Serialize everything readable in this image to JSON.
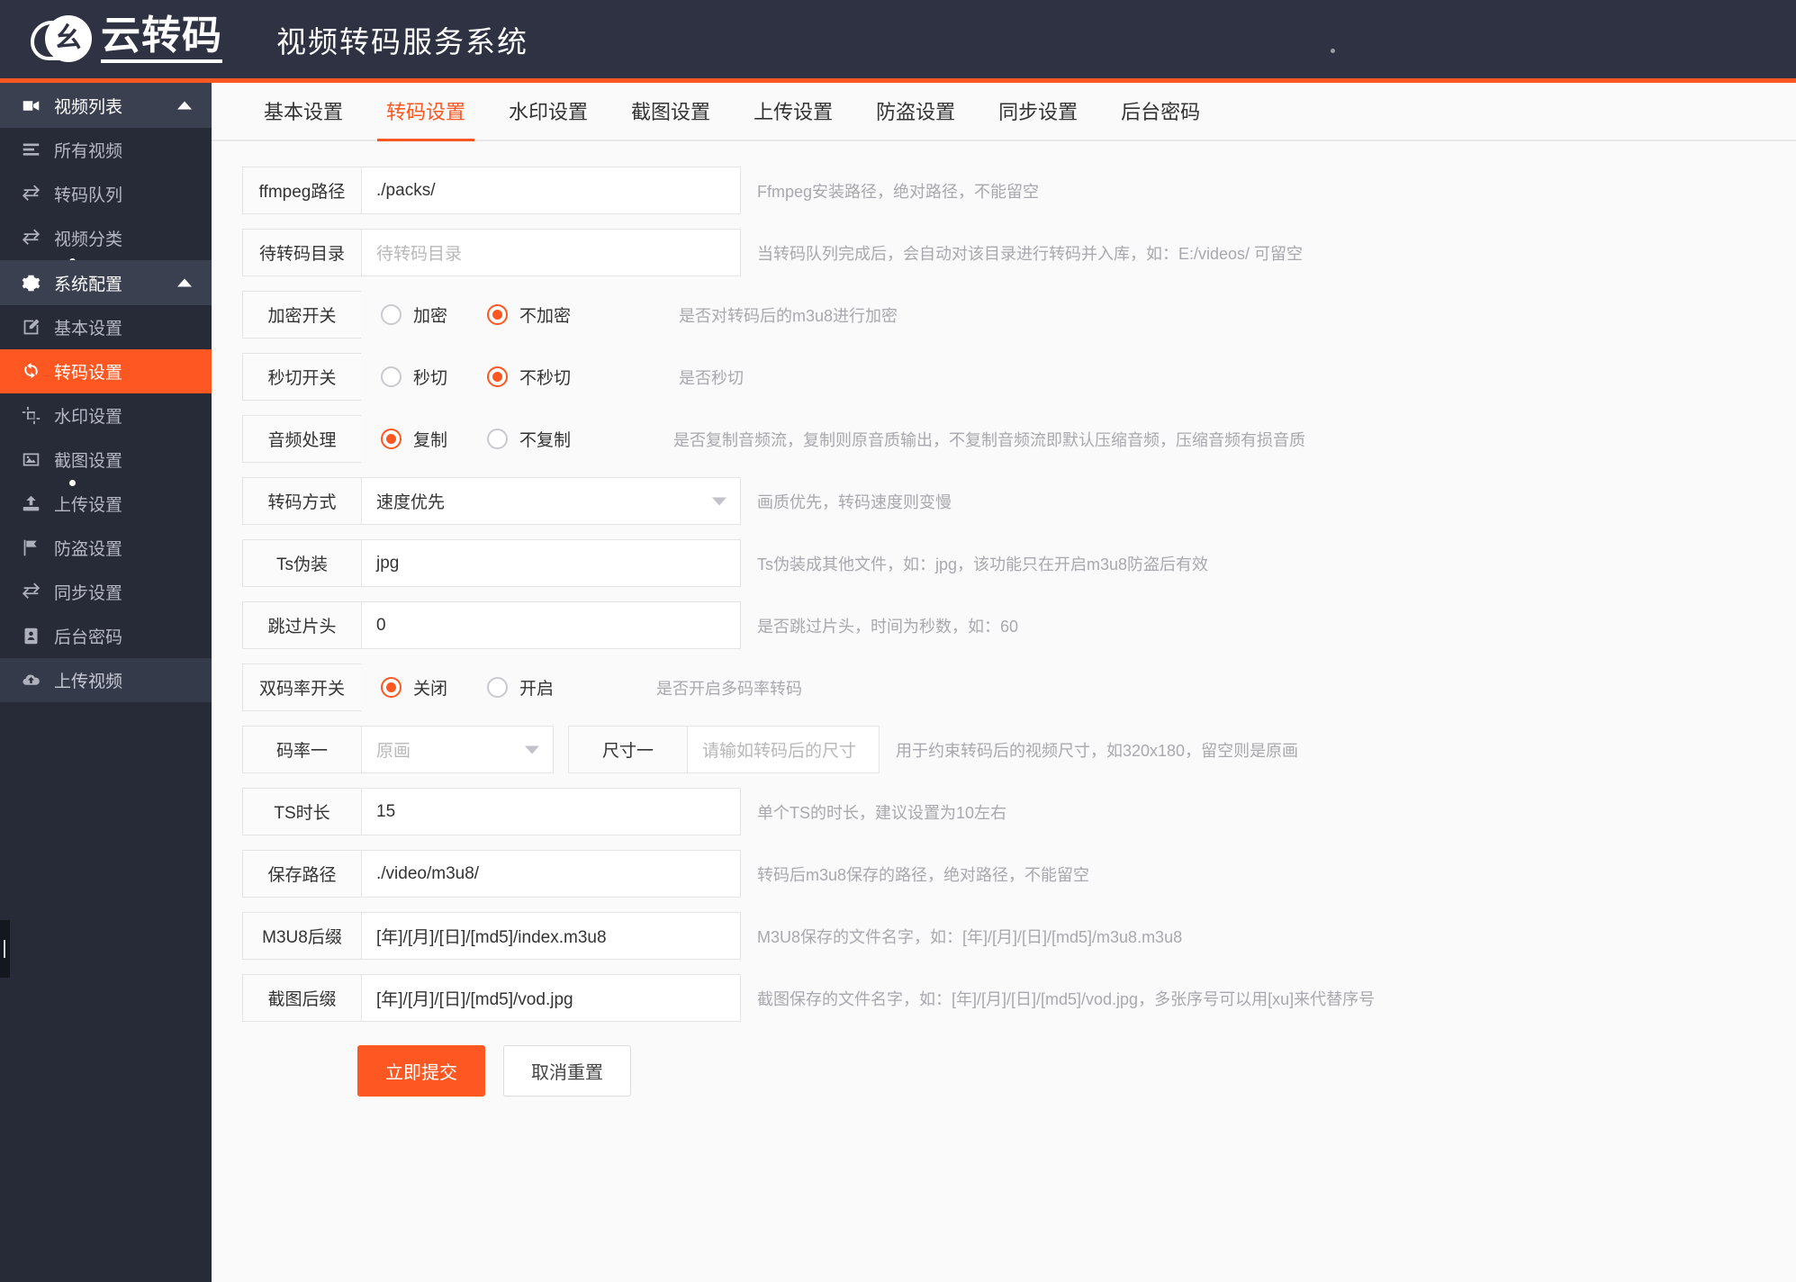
{
  "header": {
    "logo_text": "云转码",
    "logo_glyph": "幺",
    "title": "视频转码服务系统"
  },
  "sidebar": {
    "items": [
      {
        "label": "视频列表",
        "icon": "video-camera-icon",
        "type": "group",
        "active": false
      },
      {
        "label": "所有视频",
        "icon": "list-icon",
        "type": "item",
        "active": false
      },
      {
        "label": "转码队列",
        "icon": "exchange-icon",
        "type": "item",
        "active": false
      },
      {
        "label": "视频分类",
        "icon": "exchange-icon",
        "type": "item",
        "active": false,
        "dot": true
      },
      {
        "label": "系统配置",
        "icon": "gear-icon",
        "type": "group",
        "active": false
      },
      {
        "label": "基本设置",
        "icon": "edit-icon",
        "type": "item",
        "active": false
      },
      {
        "label": "转码设置",
        "icon": "transcode-icon",
        "type": "item",
        "active": true
      },
      {
        "label": "水印设置",
        "icon": "crop-icon",
        "type": "item",
        "active": false
      },
      {
        "label": "截图设置",
        "icon": "image-icon",
        "type": "item",
        "active": false,
        "dot": true
      },
      {
        "label": "上传设置",
        "icon": "upload-icon",
        "type": "item",
        "active": false
      },
      {
        "label": "防盗设置",
        "icon": "flag-icon",
        "type": "item",
        "active": false
      },
      {
        "label": "同步设置",
        "icon": "exchange-icon",
        "type": "item",
        "active": false
      },
      {
        "label": "后台密码",
        "icon": "contact-icon",
        "type": "item",
        "active": false
      },
      {
        "label": "上传视频",
        "icon": "cloud-upload-icon",
        "type": "soft",
        "active": false
      }
    ]
  },
  "tabs": [
    {
      "label": "基本设置",
      "active": false
    },
    {
      "label": "转码设置",
      "active": true
    },
    {
      "label": "水印设置",
      "active": false
    },
    {
      "label": "截图设置",
      "active": false
    },
    {
      "label": "上传设置",
      "active": false
    },
    {
      "label": "防盗设置",
      "active": false
    },
    {
      "label": "同步设置",
      "active": false
    },
    {
      "label": "后台密码",
      "active": false
    }
  ],
  "form": {
    "ffmpeg_path": {
      "label": "ffmpeg路径",
      "value": "./packs/",
      "hint": "Ffmpeg安装路径，绝对路径，不能留空"
    },
    "pending_dir": {
      "label": "待转码目录",
      "placeholder": "待转码目录",
      "value": "",
      "hint": "当转码队列完成后，会自动对该目录进行转码并入库，如：E:/videos/ 可留空"
    },
    "encrypt_switch": {
      "label": "加密开关",
      "options": [
        {
          "label": "加密",
          "selected": false
        },
        {
          "label": "不加密",
          "selected": true
        }
      ],
      "hint": "是否对转码后的m3u8进行加密"
    },
    "fastcut_switch": {
      "label": "秒切开关",
      "options": [
        {
          "label": "秒切",
          "selected": false
        },
        {
          "label": "不秒切",
          "selected": true
        }
      ],
      "hint": "是否秒切"
    },
    "audio_process": {
      "label": "音频处理",
      "options": [
        {
          "label": "复制",
          "selected": true
        },
        {
          "label": "不复制",
          "selected": false
        }
      ],
      "hint": "是否复制音频流，复制则原音质输出，不复制音频流即默认压缩音频，压缩音频有损音质"
    },
    "transcode_mode": {
      "label": "转码方式",
      "value": "速度优先",
      "hint": "画质优先，转码速度则变慢"
    },
    "ts_disguise": {
      "label": "Ts伪装",
      "value": "jpg",
      "hint": "Ts伪装成其他文件，如：jpg，该功能只在开启m3u8防盗后有效"
    },
    "skip_intro": {
      "label": "跳过片头",
      "value": "0",
      "hint": "是否跳过片头，时间为秒数，如：60"
    },
    "dual_bitrate": {
      "label": "双码率开关",
      "options": [
        {
          "label": "关闭",
          "selected": true
        },
        {
          "label": "开启",
          "selected": false
        }
      ],
      "hint": "是否开启多码率转码"
    },
    "bitrate_one": {
      "label": "码率一",
      "value": "原画"
    },
    "size_one": {
      "label": "尺寸一",
      "placeholder": "请输如转码后的尺寸",
      "value": "",
      "hint": "用于约束转码后的视频尺寸，如320x180，留空则是原画"
    },
    "ts_duration": {
      "label": "TS时长",
      "value": "15",
      "hint": "单个TS的时长，建议设置为10左右"
    },
    "save_path": {
      "label": "保存路径",
      "value": "./video/m3u8/",
      "hint": "转码后m3u8保存的路径，绝对路径，不能留空"
    },
    "m3u8_suffix": {
      "label": "M3U8后缀",
      "value": "[年]/[月]/[日]/[md5]/index.m3u8",
      "hint": "M3U8保存的文件名字，如：[年]/[月]/[日]/[md5]/m3u8.m3u8"
    },
    "shot_suffix": {
      "label": "截图后缀",
      "value": "[年]/[月]/[日]/[md5]/vod.jpg",
      "hint": "截图保存的文件名字，如：[年]/[月]/[日]/[md5]/vod.jpg，多张序号可以用[xu]来代替序号"
    }
  },
  "buttons": {
    "submit": "立即提交",
    "reset": "取消重置"
  },
  "colors": {
    "accent": "#ff5722",
    "sidebar_bg": "#272b38",
    "topbar_bg": "#2f3242"
  }
}
